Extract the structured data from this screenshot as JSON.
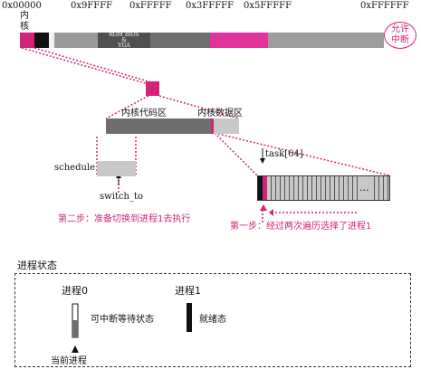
{
  "memory_map": {
    "addresses": [
      "0x00000",
      "0x9FFFF",
      "0xFFFFF",
      "0x3FFFFF",
      "0x5FFFFF",
      "0xFFFFFF"
    ],
    "kernel_label": "内核",
    "rom_label_1": "ROM BIOS",
    "rom_label_2": "&",
    "rom_label_3": "VGA",
    "interrupt_badge": "允许中断"
  },
  "kernel_detail": {
    "code_label": "内核代码区",
    "data_label": "内核数据区"
  },
  "schedule": {
    "label": "schedule",
    "switch_label": "switch_to"
  },
  "task_array": {
    "label": "task[64]",
    "ellipsis": "..."
  },
  "steps": {
    "step2": "第二步：准备切换到进程1去执行",
    "step1": "第一步：经过两次遍历选择了进程1"
  },
  "legend": {
    "title": "进程状态",
    "proc0": "进程0",
    "proc1": "进程1",
    "interruptible": "可中断等待状态",
    "ready": "就绪态",
    "current": "当前进程"
  },
  "colors": {
    "accent": "#d4237a",
    "dark_gray": "#6e6e6e",
    "mid_gray": "#8c8c8c",
    "light_gray": "#c8c8c8",
    "black": "#111111"
  }
}
